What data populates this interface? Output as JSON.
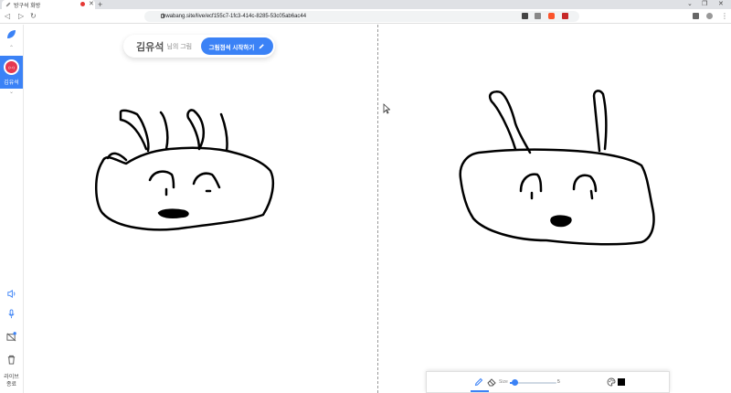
{
  "browser": {
    "tab_title": "방구석 화방",
    "url": "hwabang.site/live/ecf155c7-1fc3-414c-8285-53c05ab6ac44",
    "win_min": "⌄",
    "win_max": "❐",
    "win_restore": "–",
    "win_close": "✕"
  },
  "sidebar": {
    "user": {
      "avatar_text": "(•.•)",
      "name": "김유석"
    },
    "leave_label_1": "라이브",
    "leave_label_2": "종료"
  },
  "header": {
    "owner_name": "김유석",
    "owner_suffix": "님의 그림",
    "start_button": "그림점석 시작하기"
  },
  "toolbar": {
    "size_label": "Size",
    "size_value": "5",
    "size_fraction": 0.1,
    "color": "#000000"
  },
  "colors": {
    "accent": "#3b82f6",
    "avatar": "#e53950",
    "ink": "#000000"
  }
}
